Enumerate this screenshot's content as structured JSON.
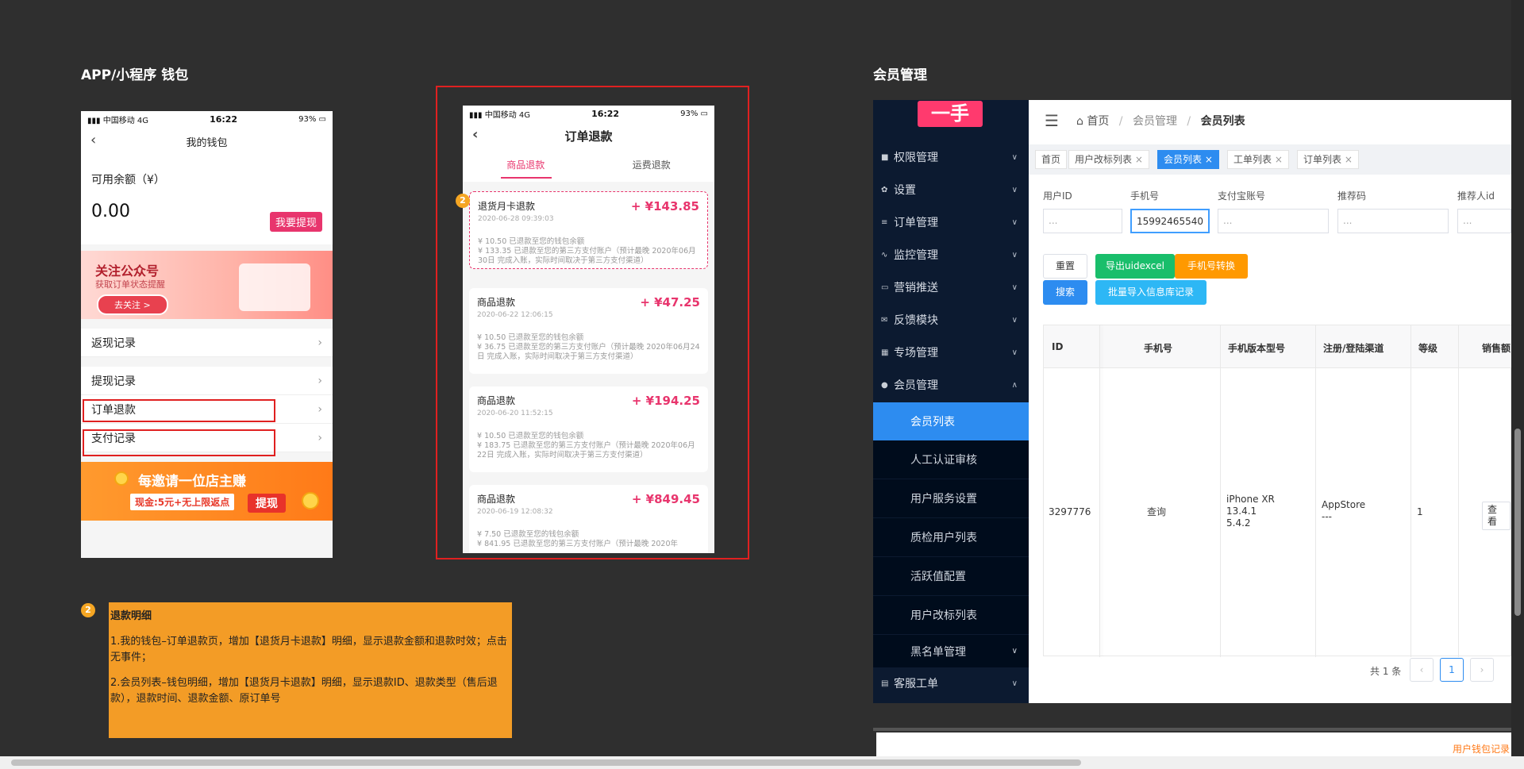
{
  "left_section": {
    "title": "APP/小程序 钱包"
  },
  "right_section": {
    "title": "会员管理"
  },
  "wallet_phone": {
    "status": {
      "carrier": "中国移动",
      "network": "4G",
      "time": "16:22",
      "battery": "93%"
    },
    "nav_title": "我的钱包",
    "balance_label": "可用余额（¥）",
    "balance_value": "0.00",
    "withdraw_button": "我要提现",
    "banner1": {
      "title": "关注公众号",
      "subtitle": "获取订单状态提醒",
      "button": "去关注 >"
    },
    "rows": [
      "返现记录",
      "提现记录",
      "订单退款",
      "支付记录"
    ],
    "banner2": {
      "title": "每邀请一位店主赚",
      "sub": "现金:5元+无上限返点",
      "button": "提现"
    }
  },
  "refund_phone": {
    "status": {
      "carrier": "中国移动",
      "network": "4G",
      "time": "16:22",
      "battery": "93%"
    },
    "nav_title": "订单退款",
    "tabs": [
      "商品退款",
      "运费退款"
    ],
    "badge": "2",
    "cards": [
      {
        "title": "退货月卡退款",
        "amount": "+ ¥143.85",
        "date": "2020-06-28 09:39:03",
        "line1": "¥ 10.50 已退款至您的钱包余额",
        "line2": "¥ 133.35 已退款至您的第三方支付账户（预计最晚 2020年06月30日 完成入账，实际时间取决于第三方支付渠道）"
      },
      {
        "title": "商品退款",
        "amount": "+ ¥47.25",
        "date": "2020-06-22 12:06:15",
        "line1": "¥ 10.50 已退款至您的钱包余额",
        "line2": "¥ 36.75 已退款至您的第三方支付账户（预计最晚 2020年06月24日 完成入账，实际时间取决于第三方支付渠道）"
      },
      {
        "title": "商品退款",
        "amount": "+ ¥194.25",
        "date": "2020-06-20 11:52:15",
        "line1": "¥ 10.50 已退款至您的钱包余额",
        "line2": "¥ 183.75 已退款至您的第三方支付账户（预计最晚 2020年06月22日 完成入账，实际时间取决于第三方支付渠道）"
      },
      {
        "title": "商品退款",
        "amount": "+ ¥849.45",
        "date": "2020-06-19 12:08:32",
        "line1": "¥ 7.50 已退款至您的钱包余额",
        "line2": "¥ 841.95 已退款至您的第三方支付账户（预计最晚 2020年"
      }
    ]
  },
  "note": {
    "badge": "2",
    "title": "退款明细",
    "p1": "1.我的钱包–订单退款页，增加【退货月卡退款】明细，显示退款金额和退款时效；点击无事件；",
    "p2": "2.会员列表–钱包明细，增加【退货月卡退款】明细，显示退款ID、退款类型（售后退款），退款时间、退款金额、原订单号"
  },
  "admin": {
    "logo": "一手",
    "breadcrumb": [
      "首页",
      "会员管理",
      "会员列表"
    ],
    "sidebar": [
      {
        "label": "权限管理",
        "icon": "lock-icon"
      },
      {
        "label": "设置",
        "icon": "gear-icon"
      },
      {
        "label": "订单管理",
        "icon": "list-icon"
      },
      {
        "label": "监控管理",
        "icon": "pulse-icon"
      },
      {
        "label": "营销推送",
        "icon": "card-icon"
      },
      {
        "label": "反馈模块",
        "icon": "mail-icon"
      },
      {
        "label": "专场管理",
        "icon": "grid-icon"
      },
      {
        "label": "会员管理",
        "icon": "users-icon"
      }
    ],
    "sub_items": [
      "会员列表",
      "人工认证审核",
      "用户服务设置",
      "质检用户列表",
      "活跃值配置",
      "用户改标列表",
      "黑名单管理"
    ],
    "bottom_item": "客服工单",
    "tags": [
      "首页",
      "用户改标列表",
      "会员列表",
      "工单列表",
      "订单列表"
    ],
    "filters": [
      {
        "label": "用户ID",
        "value": "..."
      },
      {
        "label": "手机号",
        "value": "15992465540"
      },
      {
        "label": "支付宝账号",
        "value": "..."
      },
      {
        "label": "推荐码",
        "value": "..."
      },
      {
        "label": "推荐人id",
        "value": "..."
      }
    ],
    "buttons": {
      "reset": "重置",
      "export": "导出uidexcel",
      "phone_convert": "手机号转换",
      "search": "搜索",
      "batch_import": "批量导入信息库记录"
    },
    "table": {
      "headers": [
        "ID",
        "手机号",
        "手机版本型号",
        "注册/登陆渠道",
        "等级",
        "销售额"
      ],
      "row": {
        "id": "3297776",
        "phone": "查询",
        "model1": "iPhone XR",
        "model2": "13.4.1",
        "model3": "5.4.2",
        "channel1": "AppStore",
        "channel2": "---",
        "level": "1",
        "action": "查看"
      }
    },
    "pagination": {
      "total": "共 1 条",
      "page": "1"
    },
    "bottom_link": "用户钱包记录"
  }
}
